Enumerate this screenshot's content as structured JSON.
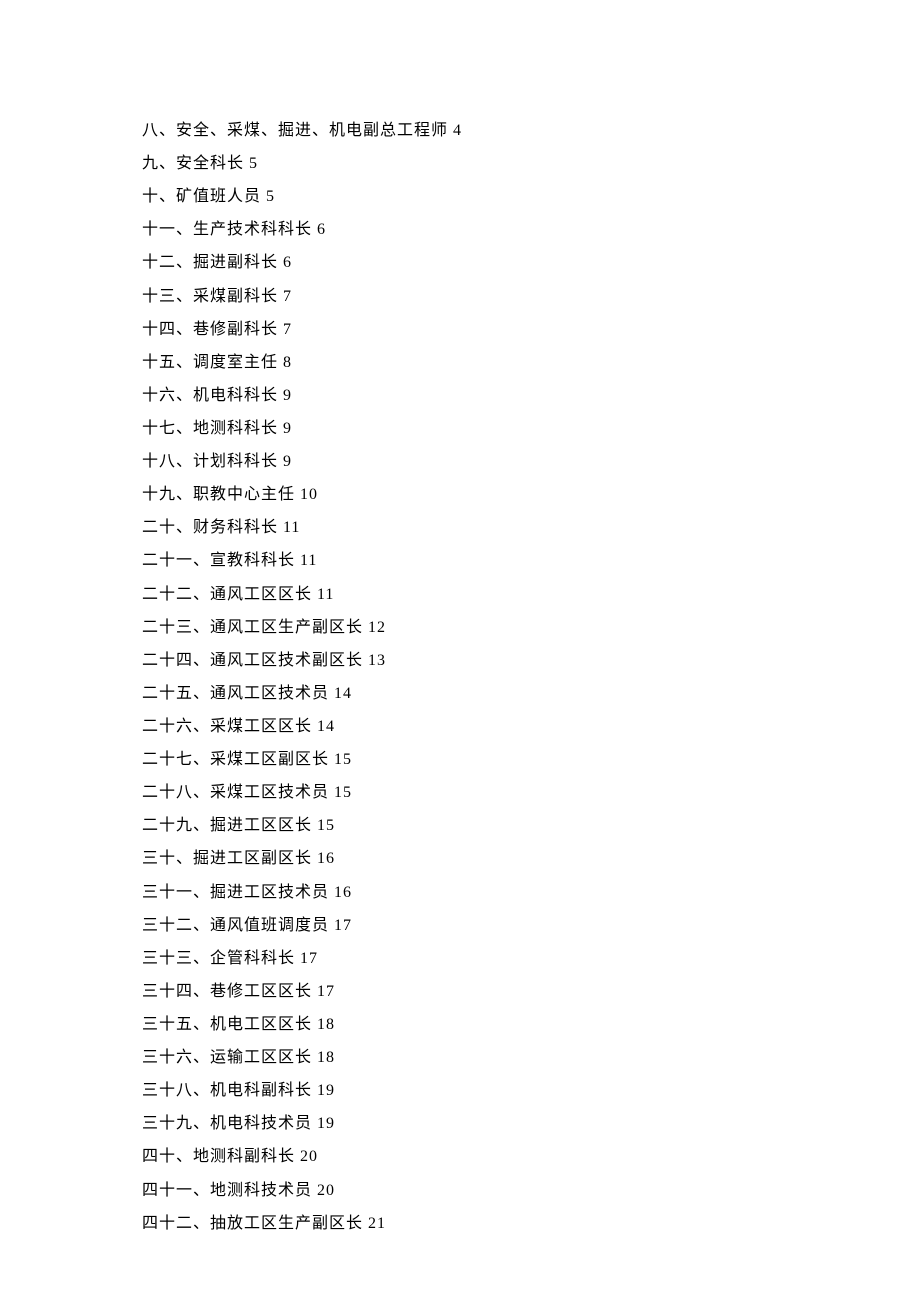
{
  "lines": [
    "八、安全、采煤、掘进、机电副总工程师 4",
    "九、安全科长 5",
    "十、矿值班人员 5",
    "十一、生产技术科科长 6",
    "十二、掘进副科长 6",
    "十三、采煤副科长 7",
    "十四、巷修副科长 7",
    "十五、调度室主任 8",
    "十六、机电科科长 9",
    "十七、地测科科长 9",
    "十八、计划科科长 9",
    "十九、职教中心主任 10",
    "二十、财务科科长 11",
    "二十一、宣教科科长 11",
    "二十二、通风工区区长 11",
    "二十三、通风工区生产副区长 12",
    "二十四、通风工区技术副区长 13",
    "二十五、通风工区技术员 14",
    "二十六、采煤工区区长 14",
    "二十七、采煤工区副区长 15",
    "二十八、采煤工区技术员 15",
    "二十九、掘进工区区长 15",
    "三十、掘进工区副区长 16",
    "三十一、掘进工区技术员 16",
    "三十二、通风值班调度员 17",
    "三十三、企管科科长 17",
    "三十四、巷修工区区长 17",
    "三十五、机电工区区长 18",
    "三十六、运输工区区长 18",
    "三十八、机电科副科长 19",
    "三十九、机电科技术员 19",
    "四十、地测科副科长 20",
    "四十一、地测科技术员 20",
    "四十二、抽放工区生产副区长 21"
  ]
}
